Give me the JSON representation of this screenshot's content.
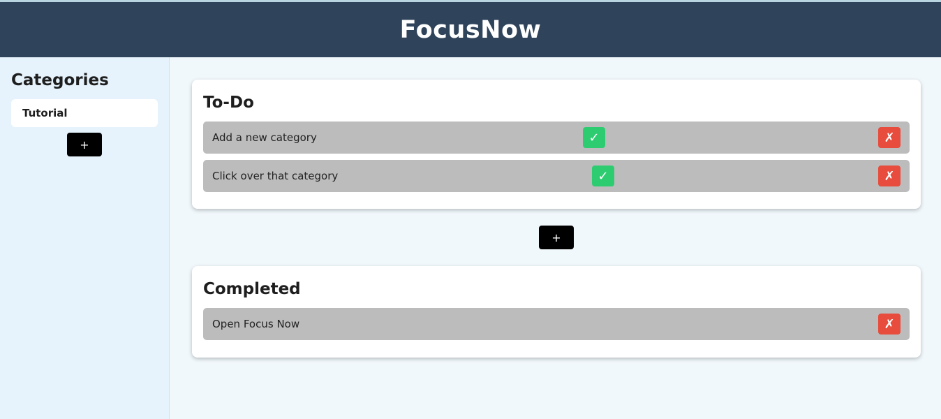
{
  "app": {
    "title": "FocusNow"
  },
  "sidebar": {
    "heading": "Categories",
    "categories": [
      {
        "label": "Tutorial"
      }
    ],
    "add_label": "+"
  },
  "todo": {
    "heading": "To-Do",
    "tasks": [
      {
        "text": "Add a new category",
        "complete_icon": "✓",
        "delete_icon": "✗"
      },
      {
        "text": "Click over that category",
        "complete_icon": "✓",
        "delete_icon": "✗"
      }
    ]
  },
  "add_task_label": "+",
  "completed": {
    "heading": "Completed",
    "tasks": [
      {
        "text": "Open Focus Now",
        "delete_icon": "✗"
      }
    ]
  },
  "colors": {
    "header": "#2f435a",
    "complete": "#2ecc71",
    "delete": "#e74c3c",
    "task_bg": "#bcbcbc"
  }
}
